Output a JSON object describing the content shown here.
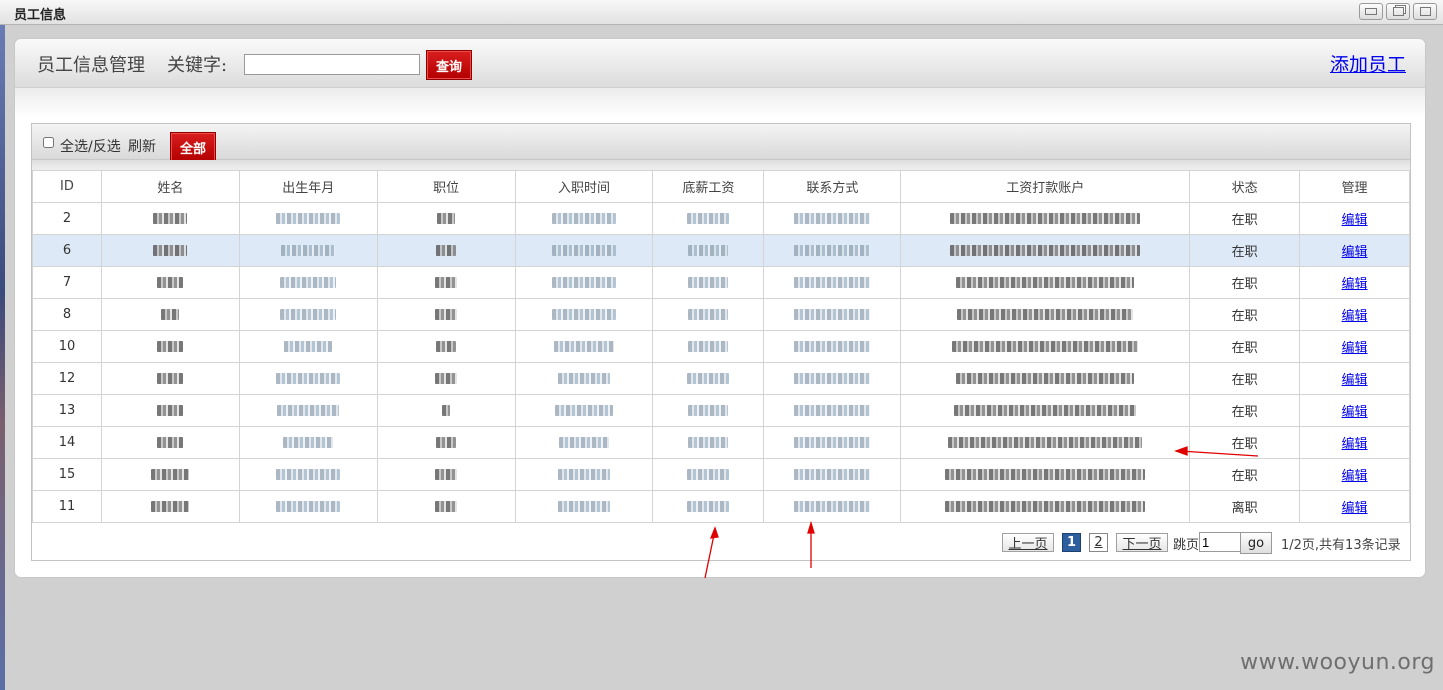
{
  "window": {
    "title": "员工信息",
    "controls": [
      "minimize-icon",
      "restore-icon",
      "close-icon"
    ]
  },
  "header": {
    "title": "员工信息管理",
    "keyword_label": "关键字:",
    "keyword_value": "",
    "search_label": "查询",
    "add_link": "添加员工"
  },
  "toolbar": {
    "select_all_label": "全选/反选",
    "refresh_label": "刷新",
    "all_label": "全部"
  },
  "table": {
    "columns": [
      "ID",
      "姓名",
      "出生年月",
      "职位",
      "入职时间",
      "底薪工资",
      "联系方式",
      "工资打款账户",
      "状态",
      "管理"
    ],
    "rows": [
      {
        "id": "2",
        "status": "在职",
        "action": "编辑",
        "selected": false
      },
      {
        "id": "6",
        "status": "在职",
        "action": "编辑",
        "selected": true
      },
      {
        "id": "7",
        "status": "在职",
        "action": "编辑",
        "selected": false
      },
      {
        "id": "8",
        "status": "在职",
        "action": "编辑",
        "selected": false
      },
      {
        "id": "10",
        "status": "在职",
        "action": "编辑",
        "selected": false
      },
      {
        "id": "12",
        "status": "在职",
        "action": "编辑",
        "selected": false
      },
      {
        "id": "13",
        "status": "在职",
        "action": "编辑",
        "selected": false
      },
      {
        "id": "14",
        "status": "在职",
        "action": "编辑",
        "selected": false
      },
      {
        "id": "15",
        "status": "在职",
        "action": "编辑",
        "selected": false
      },
      {
        "id": "11",
        "status": "离职",
        "action": "编辑",
        "selected": false
      }
    ]
  },
  "pager": {
    "prev_label": "上一页",
    "pages": [
      "1",
      "2"
    ],
    "current_page": "1",
    "next_label": "下一页",
    "jump_label": "跳页",
    "jump_value": "1",
    "go_label": "go",
    "info": "1/2页,共有13条记录"
  },
  "watermark": "www.wooyun.org",
  "colors": {
    "accent_red": "#c00000",
    "link_blue": "#0000ee",
    "selected_row": "#dde9f6",
    "annotation_red": "#e00000"
  }
}
